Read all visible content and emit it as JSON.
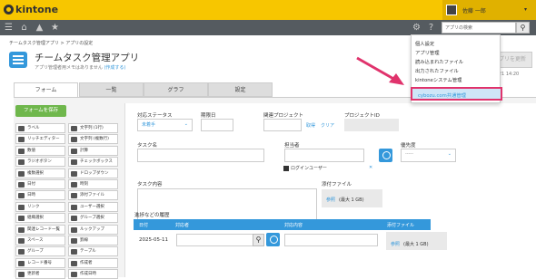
{
  "top": {
    "logo": "kintone",
    "user": "佐藤 一郎"
  },
  "nav": {
    "search_placeholder": "アプリの検索"
  },
  "breadcrumb": "チームタスク管理アプリ > アプリの設定",
  "app": {
    "title": "チームタスク管理アプリ",
    "memo_prefix": "アプリ管理者用メモはありません",
    "memo_link": "(作成する)",
    "update_button": "アプリを更新",
    "updated": "4/21 14:20"
  },
  "tabs": [
    "フォーム",
    "一覧",
    "グラフ",
    "設定"
  ],
  "save_button": "フォームを保存",
  "parts": [
    [
      "ラベル",
      "文字列 (1行)"
    ],
    [
      "リッチエディター",
      "文字列 (複数行)"
    ],
    [
      "数値",
      "計算"
    ],
    [
      "ラジオボタン",
      "チェックボックス"
    ],
    [
      "複数選択",
      "ドロップダウン"
    ],
    [
      "日付",
      "時刻"
    ],
    [
      "日時",
      "添付ファイル"
    ],
    [
      "リンク",
      "ユーザー選択"
    ],
    [
      "組織選択",
      "グループ選択"
    ],
    [
      "関連レコード一覧",
      "ルックアップ"
    ],
    [
      "スペース",
      "罫線"
    ],
    [
      "グループ",
      "テーブル"
    ],
    [
      "レコード番号",
      "作成者"
    ],
    [
      "更新者",
      "作成日時"
    ]
  ],
  "form": {
    "status_label": "対応ステータス",
    "status_value": "未着手",
    "due_label": "期限日",
    "project_label": "関連プロジェクト",
    "fetch": "取得",
    "clear": "クリア",
    "project_id_label": "プロジェクトID",
    "task_label": "タスク名",
    "assignee_label": "担当者",
    "login_user": "ログインユーザー",
    "remove": "✕",
    "priority_label": "優先度",
    "priority_value": "-----",
    "content_label": "タスク内容",
    "attach_label": "添付ファイル",
    "browse": "参照",
    "max": "(最大 1 GB)",
    "history_label": "進捗などの履歴",
    "history_cols": [
      "日付",
      "対応者",
      "対応内容",
      "添付ファイル"
    ],
    "history_date": "2025-05-11"
  },
  "menu": [
    "個人設定",
    "アプリ管理",
    "読み込まれたファイル",
    "出力されたファイル",
    "kintoneシステム管理",
    "cybozu.com共通管理"
  ],
  "colors": {
    "header": "#f7c600",
    "accent": "#3498db",
    "highlight": "#e0336c",
    "save": "#6fb74c"
  }
}
